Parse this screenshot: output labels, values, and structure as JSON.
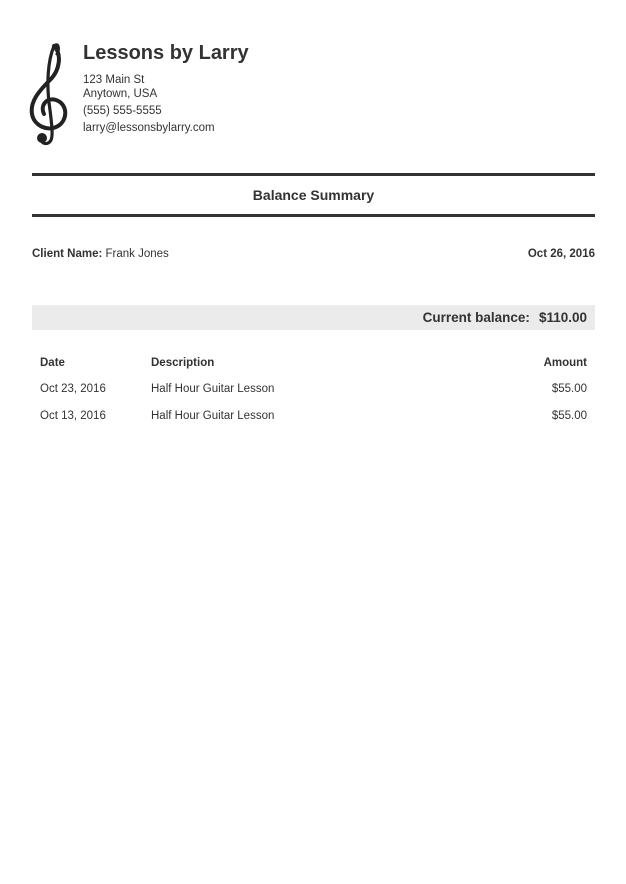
{
  "business": {
    "name": "Lessons by Larry",
    "address_line1": "123 Main St",
    "address_line2": "Anytown, USA",
    "phone": "(555) 555-5555",
    "email": "larry@lessonsbylarry.com",
    "logo_icon": "treble-clef-icon"
  },
  "document": {
    "title": "Balance Summary",
    "date": "Oct 26, 2016"
  },
  "client": {
    "label": "Client Name:",
    "name": "Frank Jones"
  },
  "balance": {
    "label": "Current balance:",
    "amount": "$110.00"
  },
  "table": {
    "headers": {
      "date": "Date",
      "description": "Description",
      "amount": "Amount"
    },
    "rows": [
      {
        "date": "Oct 23, 2016",
        "description": "Half Hour Guitar Lesson",
        "amount": "$55.00"
      },
      {
        "date": "Oct 13, 2016",
        "description": "Half Hour Guitar Lesson",
        "amount": "$55.00"
      }
    ]
  },
  "colors": {
    "text": "#333333",
    "rule": "#333333",
    "balance_background": "#ebebeb"
  }
}
